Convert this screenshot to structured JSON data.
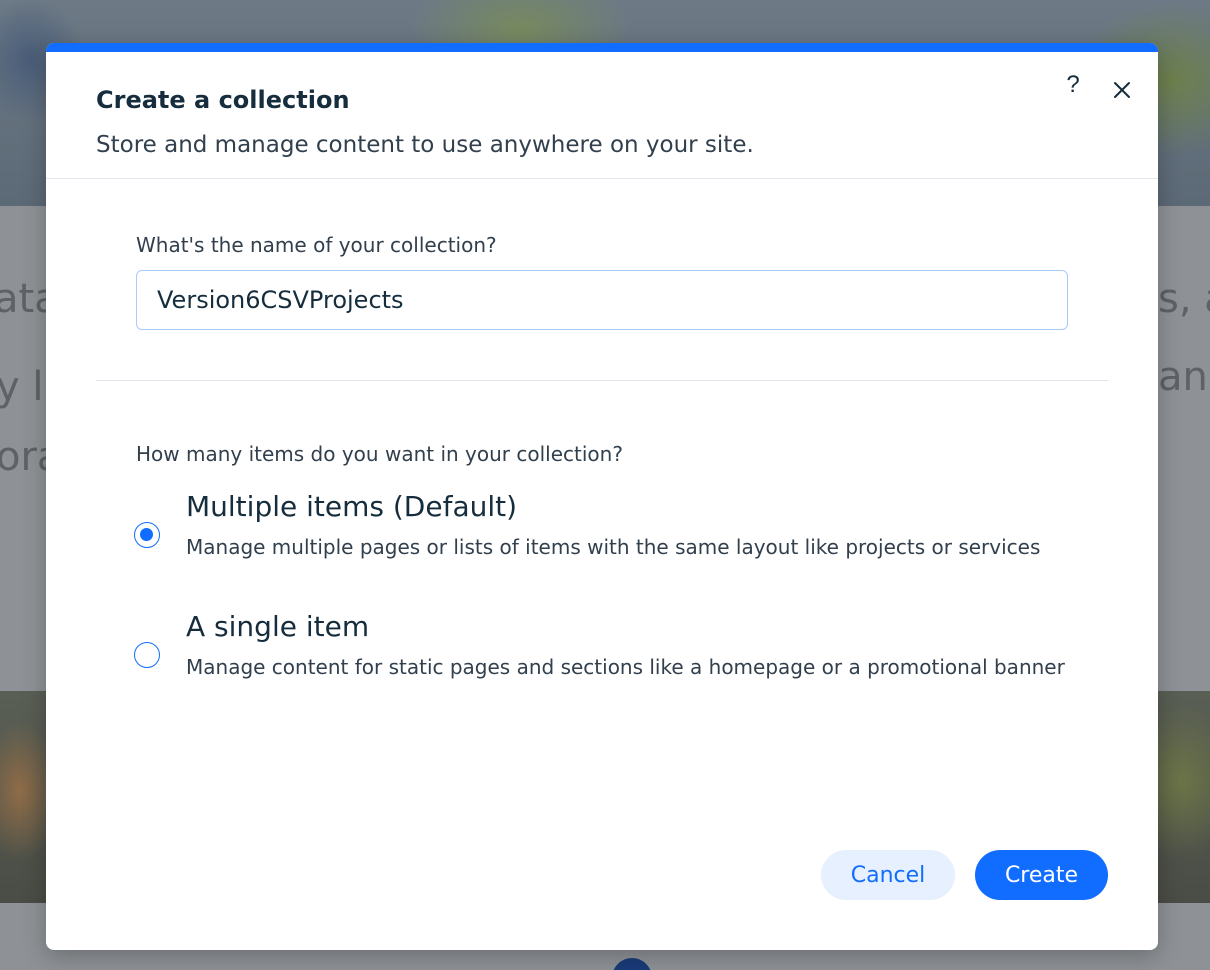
{
  "background": {
    "left_text_lines": [
      "ata",
      "y l",
      "ora"
    ],
    "right_text_lines": [
      "s, a",
      "anc"
    ]
  },
  "dialog": {
    "title": "Create a collection",
    "subtitle": "Store and manage content to use anywhere on your site.",
    "help_icon": "question-mark-icon",
    "help_glyph": "?",
    "close_icon": "close-icon"
  },
  "name_field": {
    "label": "What's the name of your collection?",
    "value": "Version6CSVProjects"
  },
  "items_question": {
    "label": "How many items do you want in your collection?",
    "options": [
      {
        "title": "Multiple items (Default)",
        "description": "Manage multiple pages or lists of items with the same layout like projects or services",
        "selected": true
      },
      {
        "title": "A single item",
        "description": "Manage content for static pages and sections like a homepage or a promotional banner",
        "selected": false
      }
    ]
  },
  "footer": {
    "cancel_label": "Cancel",
    "create_label": "Create"
  },
  "colors": {
    "accent": "#116dff",
    "accent_light": "#e7f0ff",
    "text_primary": "#162d3d",
    "text_secondary": "#32404e"
  }
}
